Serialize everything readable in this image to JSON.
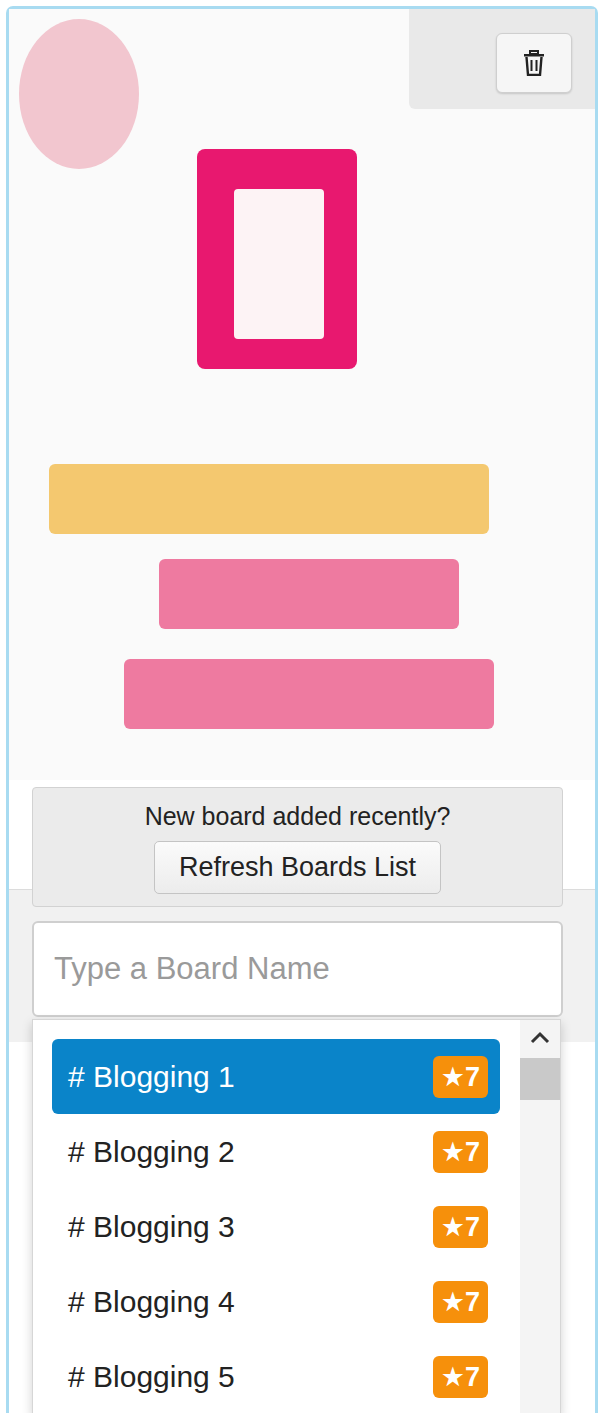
{
  "pin": {
    "image": "photo"
  },
  "refresh_panel": {
    "message": "New board added recently?",
    "button": "Refresh Boards List"
  },
  "search": {
    "placeholder": "Type a Board Name"
  },
  "boards": [
    {
      "name": "# Blogging 1",
      "badge": "★7",
      "selected": true
    },
    {
      "name": "# Blogging 2",
      "badge": "★7",
      "selected": false
    },
    {
      "name": "# Blogging 3",
      "badge": "★7",
      "selected": false
    },
    {
      "name": "# Blogging 4",
      "badge": "★7",
      "selected": false
    },
    {
      "name": "# Blogging 5",
      "badge": "★7",
      "selected": false
    }
  ]
}
